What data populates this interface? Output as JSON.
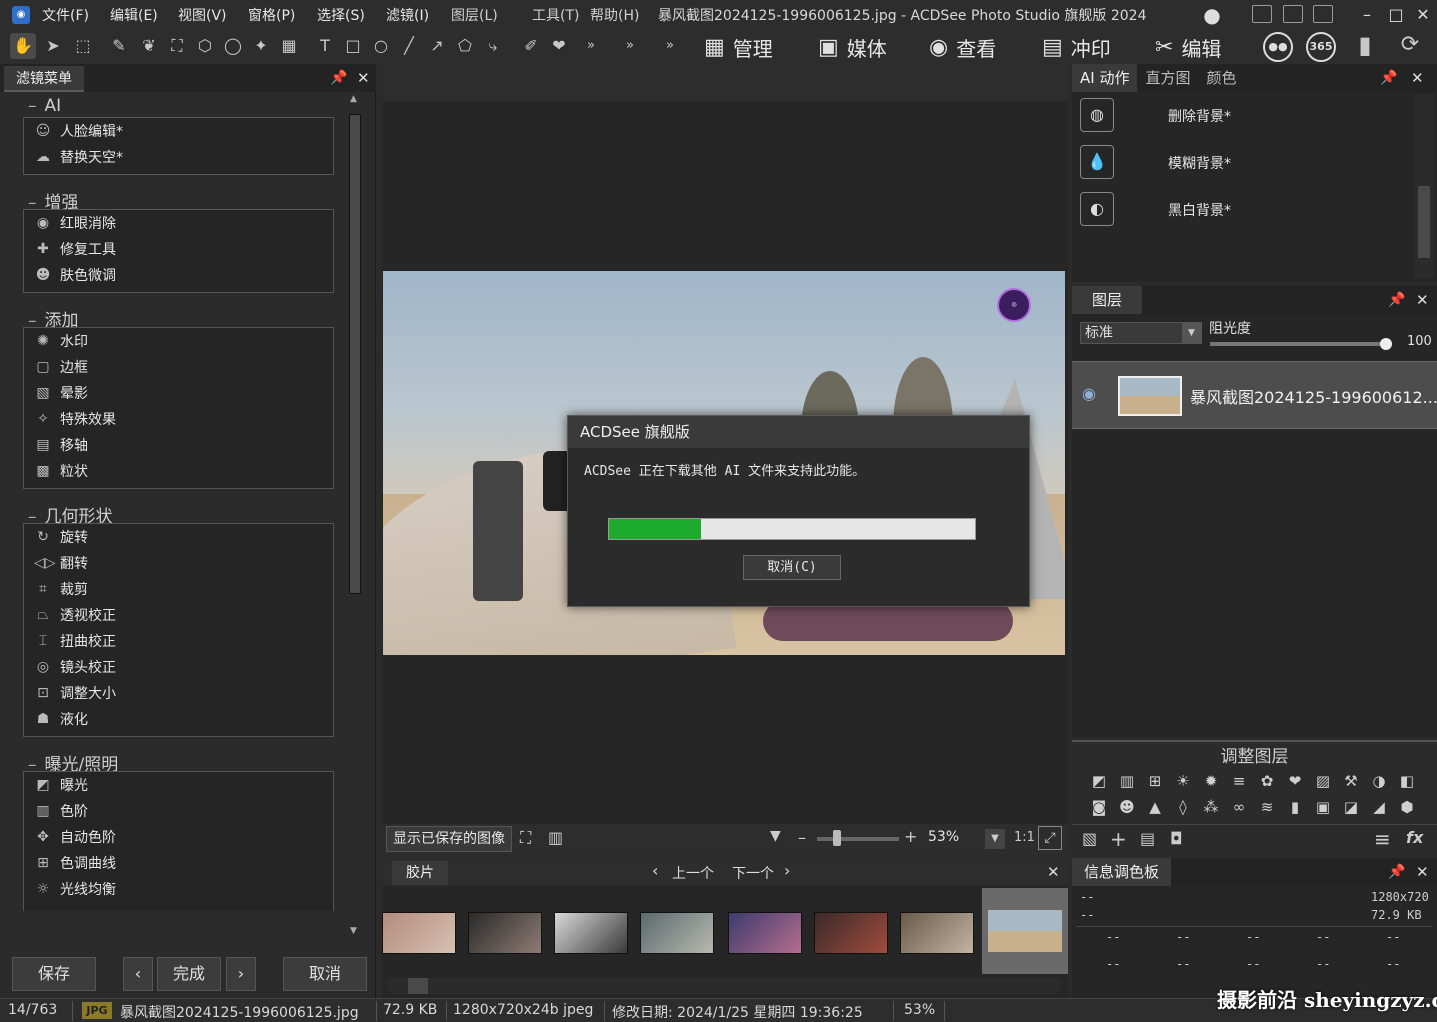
{
  "window": {
    "title": "暴风截图2024125-1996006125.jpg - ACDSee Photo Studio 旗舰版 2024",
    "menu": [
      "文件(F)",
      "编辑(E)",
      "视图(V)",
      "窗格(P)",
      "选择(S)",
      "滤镜(I)",
      "图层(L)",
      "工具(T)",
      "帮助(H)"
    ]
  },
  "modes": {
    "manage": "管理",
    "media": "媒体",
    "view": "查看",
    "develop": "冲印",
    "edit": "编辑",
    "b365": "365"
  },
  "left_panel": {
    "title": "滤镜菜单",
    "sections": [
      {
        "title": "AI",
        "items": [
          {
            "label": "人脸编辑*",
            "icon": "face-icon"
          },
          {
            "label": "替换天空*",
            "icon": "sky-icon"
          }
        ]
      },
      {
        "title": "增强",
        "items": [
          {
            "label": "红眼消除",
            "icon": "eye-icon"
          },
          {
            "label": "修复工具",
            "icon": "bandage-icon"
          },
          {
            "label": "肤色微调",
            "icon": "person-icon"
          }
        ]
      },
      {
        "title": "添加",
        "items": [
          {
            "label": "水印",
            "icon": "watermark-icon"
          },
          {
            "label": "边框",
            "icon": "border-icon"
          },
          {
            "label": "晕影",
            "icon": "vignette-icon"
          },
          {
            "label": "特殊效果",
            "icon": "magic-wand-icon"
          },
          {
            "label": "移轴",
            "icon": "tilt-shift-icon"
          },
          {
            "label": "粒状",
            "icon": "grain-icon"
          }
        ]
      },
      {
        "title": "几何形状",
        "items": [
          {
            "label": "旋转",
            "icon": "rotate-icon"
          },
          {
            "label": "翻转",
            "icon": "flip-icon"
          },
          {
            "label": "裁剪",
            "icon": "crop-icon"
          },
          {
            "label": "透视校正",
            "icon": "perspective-icon"
          },
          {
            "label": "扭曲校正",
            "icon": "distortion-icon"
          },
          {
            "label": "镜头校正",
            "icon": "lens-icon"
          },
          {
            "label": "调整大小",
            "icon": "resize-icon"
          },
          {
            "label": "液化",
            "icon": "liquify-icon"
          }
        ]
      },
      {
        "title": "曝光/照明",
        "items": [
          {
            "label": "曝光",
            "icon": "exposure-icon"
          },
          {
            "label": "色阶",
            "icon": "levels-icon"
          },
          {
            "label": "自动色阶",
            "icon": "auto-levels-icon"
          },
          {
            "label": "色调曲线",
            "icon": "curves-icon"
          },
          {
            "label": "光线均衡",
            "icon": "light-eq-icon"
          }
        ]
      }
    ],
    "buttons": {
      "save": "保存",
      "done": "完成",
      "cancel": "取消"
    }
  },
  "dialog": {
    "title": "ACDSee 旗舰版",
    "message": "ACDSee 正在下载其他 AI 文件来支持此功能。",
    "progress": 0.25,
    "cancel": "取消(C)"
  },
  "view_status": {
    "saved_label": "显示已保存的图像",
    "zoom": "53%",
    "ratio": "1:1"
  },
  "filmstrip": {
    "title": "胶片",
    "prev": "上一个",
    "next": "下一个"
  },
  "right_ai": {
    "tabs": [
      "AI 动作",
      "直方图",
      "颜色"
    ],
    "actions": [
      "删除背景*",
      "模糊背景*",
      "黑白背景*"
    ]
  },
  "layers": {
    "title": "图层",
    "blend_mode": "标准",
    "opacity_label": "阻光度",
    "opacity_value": "100",
    "layer_name": "暴风截图2024125-199600612..."
  },
  "adjustments": {
    "title": "调整图层"
  },
  "info": {
    "title": "信息调色板",
    "left1": "--",
    "left2": "--",
    "size": "1280x720",
    "filesize": "72.9 KB",
    "cell": "--"
  },
  "statusbar": {
    "index": "14/763",
    "format": "JPG",
    "filename": "暴风截图2024125-1996006125.jpg",
    "filesize": "72.9 KB",
    "dimensions": "1280x720x24b jpeg",
    "modified": "修改日期: 2024/1/25 星期四 19:36:25",
    "zoom": "53%"
  },
  "watermark": "摄影前沿 sheyingzyz.com",
  "colors": {
    "progress": "#1cab2c",
    "accent": "#2f6fc9"
  }
}
